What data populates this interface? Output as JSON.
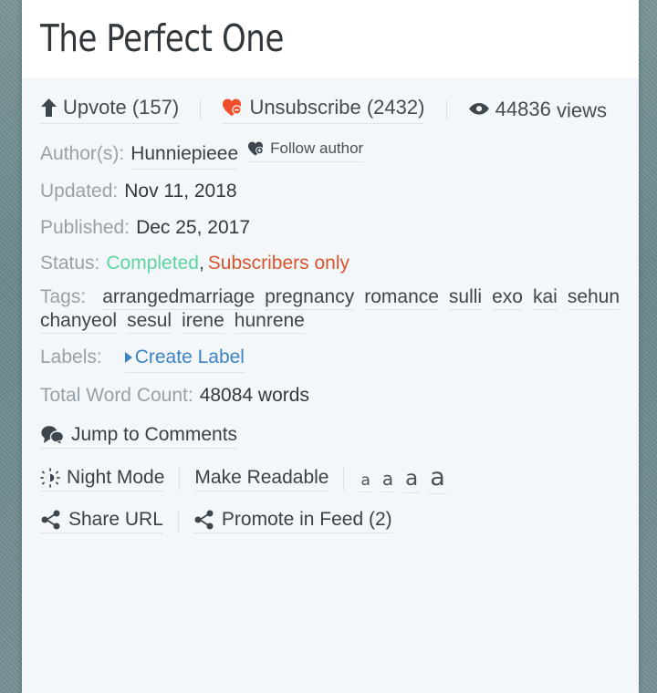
{
  "page": {
    "title": "The Perfect One"
  },
  "stats": {
    "upvote": {
      "label": "Upvote (157)",
      "icon": "arrow-up-icon",
      "count": 157
    },
    "unsubscribe": {
      "label": "Unsubscribe (2432)",
      "icon": "heart-minus-icon",
      "count": 2432,
      "color": "#ef4e2a"
    },
    "views": {
      "number": "44836",
      "suffix": " views",
      "icon": "eye-icon"
    }
  },
  "meta": {
    "author_label": "Author(s):",
    "author_name": "Hunniepieee",
    "follow_author_label": "Follow author",
    "updated_label": "Updated:",
    "updated_value": "Nov 11, 2018",
    "published_label": "Published:",
    "published_value": "Dec 25, 2017",
    "status_label": "Status:",
    "status_completed": "Completed",
    "status_separator": ",",
    "status_subscribers": "Subscribers only",
    "status_completed_color": "#5ed49e",
    "status_subscribers_color": "#d9542c"
  },
  "tags": {
    "label": "Tags:",
    "items": [
      "arrangedmarriage",
      "pregnancy",
      "romance",
      "sulli",
      "exo",
      "kai",
      "sehun",
      "chanyeol",
      "sesul",
      "irene",
      "hunrene"
    ]
  },
  "labels": {
    "label": "Labels:",
    "create_label": "Create Label",
    "create_label_color": "#3d82c4"
  },
  "wordcount": {
    "label": "Total Word Count:",
    "value": "48084 words"
  },
  "actions": {
    "jump_to_comments": "Jump to Comments",
    "night_mode": "Night Mode",
    "make_readable": "Make Readable",
    "font_sizes": [
      "a",
      "a",
      "a",
      "a"
    ],
    "share_url": "Share URL",
    "promote_in_feed": "Promote in Feed (2)"
  }
}
